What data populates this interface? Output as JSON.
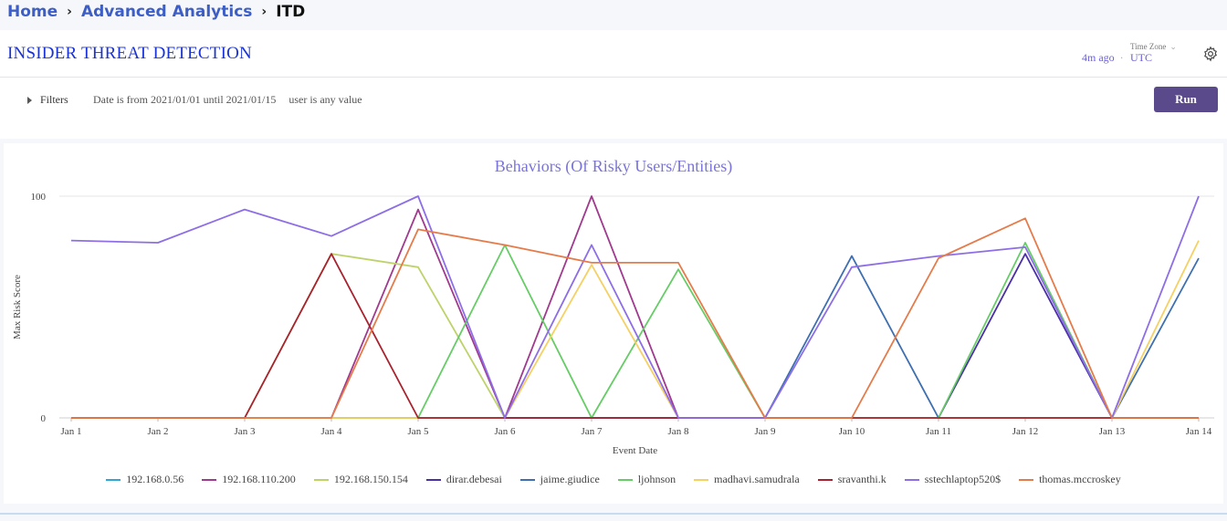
{
  "breadcrumb": {
    "home": "Home",
    "section": "Advanced Analytics",
    "current": "ITD"
  },
  "header": {
    "title": "INSIDER THREAT DETECTION",
    "updated": "4m ago",
    "timezone_label": "Time Zone",
    "timezone_value": "UTC"
  },
  "filters": {
    "label": "Filters",
    "date": "Date is from 2021/01/01 until 2021/01/15",
    "user": "user is any value"
  },
  "run_label": "Run",
  "icons": {
    "settings": "gear-icon",
    "filters": "caret-right-icon",
    "timezone": "chevron-down-icon"
  },
  "chart_data": {
    "type": "line",
    "title": "Behaviors (Of Risky Users/Entities)",
    "xlabel": "Event Date",
    "ylabel": "Max Risk Score",
    "ylim": [
      0,
      100
    ],
    "yticks": [
      0,
      100
    ],
    "grid": true,
    "legend_position": "bottom",
    "x": [
      "Jan 1",
      "Jan 2",
      "Jan 3",
      "Jan 4",
      "Jan 5",
      "Jan 6",
      "Jan 7",
      "Jan 8",
      "Jan 9",
      "Jan 10",
      "Jan 11",
      "Jan 12",
      "Jan 13",
      "Jan 14"
    ],
    "series": [
      {
        "name": "192.168.0.56",
        "color": "#2fa7d4",
        "values": [
          0,
          0,
          0,
          0,
          0,
          0,
          0,
          0,
          0,
          0,
          0,
          0,
          0,
          0
        ]
      },
      {
        "name": "192.168.110.200",
        "color": "#a03a8e",
        "values": [
          0,
          0,
          0,
          0,
          94,
          0,
          100,
          0,
          0,
          0,
          0,
          0,
          0,
          0
        ]
      },
      {
        "name": "192.168.150.154",
        "color": "#bdd36a",
        "values": [
          0,
          0,
          0,
          74,
          68,
          0,
          0,
          0,
          0,
          0,
          0,
          0,
          0,
          0
        ]
      },
      {
        "name": "dirar.debesai",
        "color": "#4b2fa6",
        "values": [
          0,
          0,
          0,
          0,
          0,
          0,
          0,
          0,
          0,
          0,
          0,
          74,
          0,
          0
        ]
      },
      {
        "name": "jaime.giudice",
        "color": "#3e6fb0",
        "values": [
          0,
          0,
          0,
          0,
          0,
          0,
          0,
          0,
          0,
          73,
          0,
          0,
          0,
          72
        ]
      },
      {
        "name": "ljohnson",
        "color": "#66cc66",
        "values": [
          0,
          0,
          0,
          0,
          0,
          78,
          0,
          67,
          0,
          0,
          0,
          79,
          0,
          0
        ]
      },
      {
        "name": "madhavi.samudrala",
        "color": "#f5d063",
        "values": [
          0,
          0,
          0,
          0,
          0,
          0,
          69,
          0,
          0,
          0,
          0,
          0,
          0,
          80
        ]
      },
      {
        "name": "sravanthi.k",
        "color": "#a8232f",
        "values": [
          0,
          0,
          0,
          74,
          0,
          0,
          0,
          0,
          0,
          0,
          0,
          0,
          0,
          0
        ]
      },
      {
        "name": "sstechlaptop520$",
        "color": "#8d6ee6",
        "values": [
          80,
          79,
          94,
          82,
          100,
          0,
          78,
          0,
          0,
          68,
          73,
          77,
          0,
          100
        ]
      },
      {
        "name": "thomas.mccroskey",
        "color": "#e57b4a",
        "values": [
          0,
          0,
          0,
          0,
          85,
          78,
          70,
          70,
          0,
          0,
          72,
          90,
          0,
          0
        ]
      }
    ]
  }
}
